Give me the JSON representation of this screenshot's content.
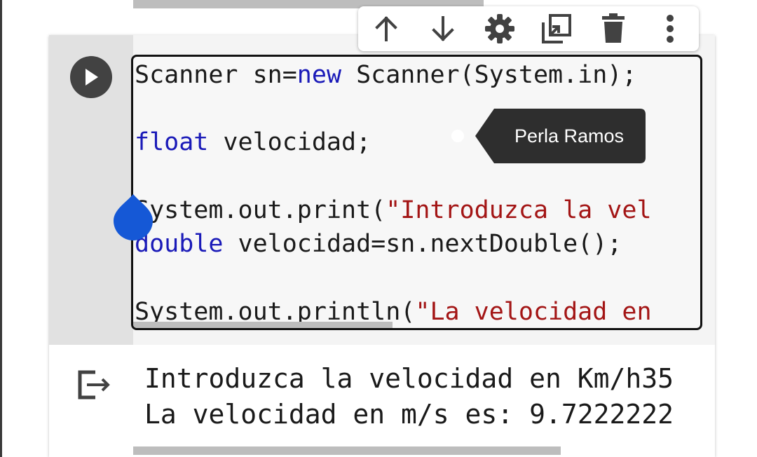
{
  "toolbar": {
    "icons": [
      "arrow-up-icon",
      "arrow-down-icon",
      "gear-icon",
      "mirror-cell-icon",
      "trash-icon",
      "more-vert-icon"
    ],
    "icon_color": "#424242"
  },
  "code": {
    "line1": {
      "plain": "Scanner sn=",
      "keyword": "new",
      "rest": " Scanner(System.in);"
    },
    "line2": {
      "keyword": "float",
      "rest": " velocidad;"
    },
    "line3": {
      "plain": "System.out.print(",
      "string": "\"Introduzca la vel"
    },
    "line4": {
      "keyword": "double",
      "rest": " velocidad=sn.nextDouble();"
    },
    "line5": {
      "plain": "System.out.println(",
      "string": "\"La velocidad en"
    }
  },
  "collaborator": {
    "name": "Perla Ramos",
    "tooltip_color": "#2e2e2e"
  },
  "output": {
    "line1": "Introduzca la velocidad en Km/h35",
    "line2": "La velocidad en m/s es: 9.7222222"
  },
  "colors": {
    "keyword": "#1a1ab8",
    "string": "#a31515",
    "selection_handle": "#1558d6",
    "run_button": "#424242"
  }
}
